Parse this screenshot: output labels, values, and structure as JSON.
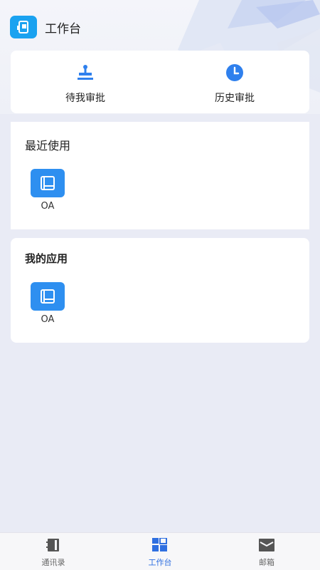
{
  "header": {
    "title": "工作台",
    "logo_icon": "phone-doc-icon"
  },
  "approvals": [
    {
      "label": "待我审批",
      "icon": "stamp-icon"
    },
    {
      "label": "历史审批",
      "icon": "clock-icon"
    }
  ],
  "recent": {
    "title": "最近使用",
    "apps": [
      {
        "label": "OA",
        "icon": "book-icon"
      }
    ]
  },
  "my_apps": {
    "title": "我的应用",
    "apps": [
      {
        "label": "OA",
        "icon": "book-icon"
      }
    ]
  },
  "tabbar": {
    "tabs": [
      {
        "label": "通讯录",
        "icon": "contacts-book-icon",
        "active": false
      },
      {
        "label": "工作台",
        "icon": "workbench-grid-icon",
        "active": true
      },
      {
        "label": "邮箱",
        "icon": "mail-icon",
        "active": false
      }
    ]
  },
  "colors": {
    "accent": "#2f6fe0",
    "app_icon": "#2e8ff0",
    "logo": "#1aa2f0",
    "background": "#e9ebf5"
  }
}
